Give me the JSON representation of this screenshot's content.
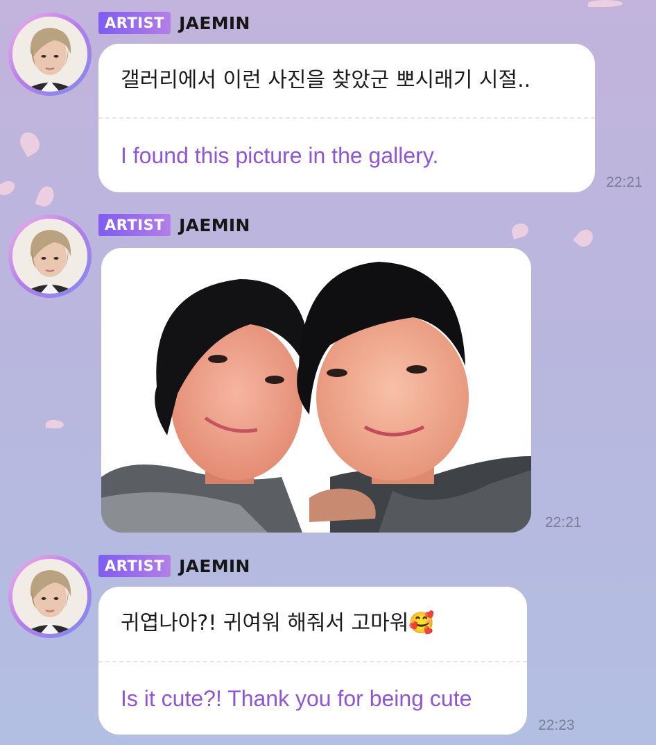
{
  "chat": {
    "messages": [
      {
        "badge": "ARTIST",
        "sender": "JAEMIN",
        "korean": "갤러리에서 이런 사진을 찾았군 뽀시래기 시절..",
        "english": "I found this picture in the gallery.",
        "time": "22:21"
      },
      {
        "badge": "ARTIST",
        "sender": "JAEMIN",
        "image": "photo-of-two-boys",
        "time": "22:21"
      },
      {
        "badge": "ARTIST",
        "sender": "JAEMIN",
        "korean": "귀엽나아?! 귀여워 해줘서 고마워🥰",
        "english": "Is it cute?! Thank you for being cute",
        "time": "22:23"
      }
    ]
  },
  "colors": {
    "badge_gradient_start": "#7f5cf0",
    "badge_gradient_end": "#b37fe6",
    "translation_text": "#8f56d4",
    "background_top": "#c2b4dc",
    "background_bottom": "#b2bfe2",
    "bubble": "#ffffff"
  },
  "icons": {
    "avatar": "artist-profile-avatar",
    "emoji": "smiling-face-with-hearts"
  }
}
